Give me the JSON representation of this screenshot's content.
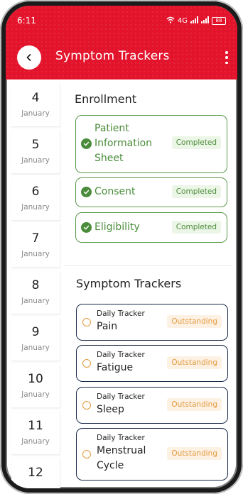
{
  "status": {
    "time": "6:11",
    "signal": "4G",
    "battery": "88"
  },
  "header": {
    "title": "Symptom Trackers"
  },
  "dates": [
    {
      "day": "4",
      "month": "January"
    },
    {
      "day": "5",
      "month": "January"
    },
    {
      "day": "6",
      "month": "January"
    },
    {
      "day": "7",
      "month": "January"
    },
    {
      "day": "8",
      "month": "January"
    },
    {
      "day": "9",
      "month": "January"
    },
    {
      "day": "10",
      "month": "January"
    },
    {
      "day": "11",
      "month": "January"
    },
    {
      "day": "12",
      "month": ""
    }
  ],
  "enrollment": {
    "title": "Enrollment",
    "items": [
      {
        "line1": "Patient",
        "line2": "Information",
        "line3": "Sheet",
        "status": "Completed"
      },
      {
        "label": "Consent",
        "status": "Completed"
      },
      {
        "label": "Eligibility",
        "status": "Completed"
      }
    ]
  },
  "trackers": {
    "title": "Symptom Trackers",
    "items": [
      {
        "sub": "Daily Tracker",
        "name": "Pain",
        "status": "Outstanding"
      },
      {
        "sub": "Daily Tracker",
        "name": "Fatigue",
        "status": "Outstanding"
      },
      {
        "sub": "Daily Tracker",
        "name": "Sleep",
        "status": "Outstanding"
      },
      {
        "sub": "Daily Tracker",
        "name1": "Menstrual",
        "name2": "Cycle",
        "status": "Outstanding"
      }
    ]
  },
  "colors": {
    "header": "#e2132b",
    "green": "#4b8c3b",
    "orange": "#e49a3c",
    "navy": "#1a2a4a"
  }
}
